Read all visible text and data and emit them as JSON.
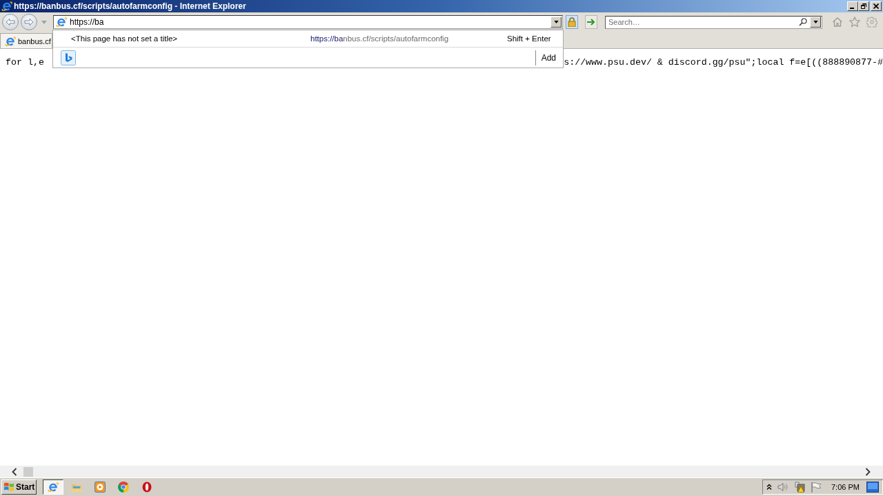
{
  "window": {
    "title": "https://banbus.cf/scripts/autofarmconfig - Internet Explorer"
  },
  "address_bar": {
    "value": "https://ba"
  },
  "search": {
    "placeholder": "Search…"
  },
  "tabs": [
    {
      "label": "banbus.cf",
      "selected": true
    }
  ],
  "autocomplete": {
    "suggestions": [
      {
        "title": "<This page has not set a title>",
        "url_typed": "https://ba",
        "url_rest": "nbus.cf/scripts/autofarmconfig",
        "shortcut": "Shift + Enter"
      }
    ],
    "add_label": "Add"
  },
  "page": {
    "text_fragments": [
      "for l,e",
      "s://www.psu.dev/ & discord.gg/psu\";local f=e[((888890877-#"
    ]
  },
  "taskbar": {
    "start_label": "Start",
    "apps": [
      {
        "kind": "e-logo",
        "selected": true
      },
      {
        "kind": "folder",
        "selected": false
      },
      {
        "kind": "play",
        "selected": false
      },
      {
        "kind": "circle-logo",
        "selected": false
      },
      {
        "kind": "o-logo",
        "selected": false
      }
    ],
    "clock": "7:06 PM"
  }
}
